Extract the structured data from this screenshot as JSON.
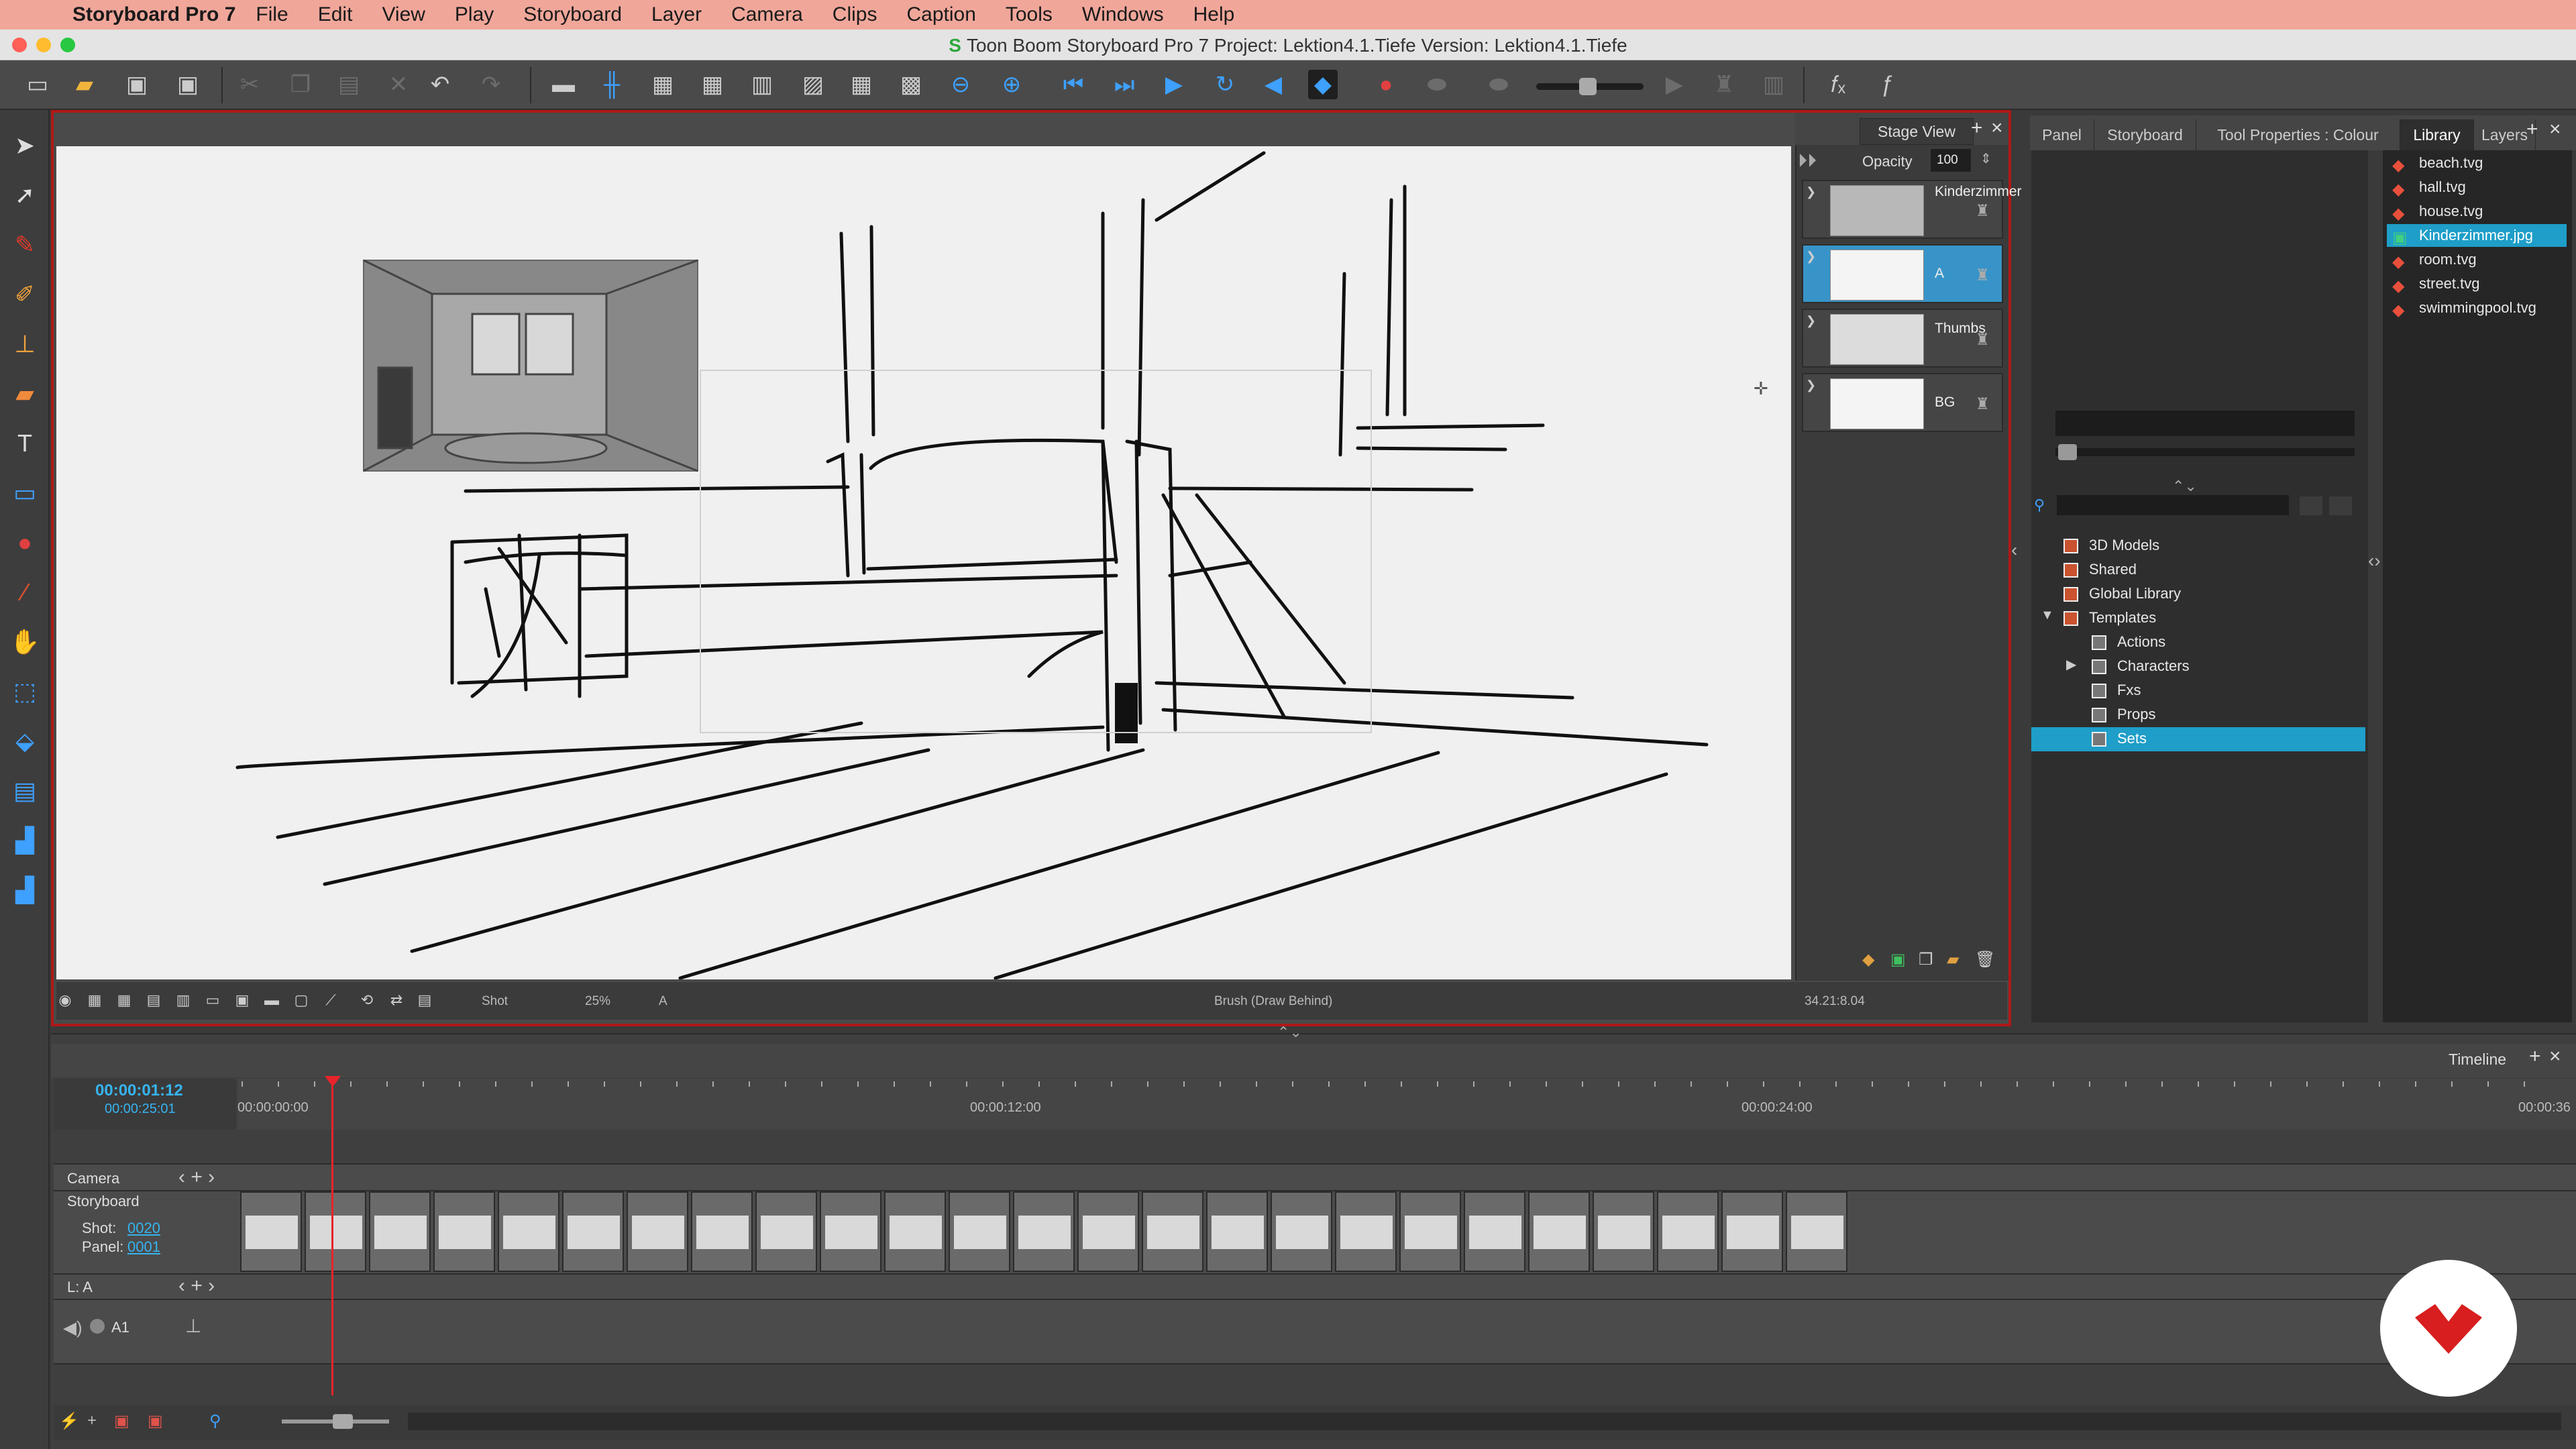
{
  "menubar": {
    "app_name": "Storyboard Pro 7",
    "items": [
      "File",
      "Edit",
      "View",
      "Play",
      "Storyboard",
      "Layer",
      "Camera",
      "Clips",
      "Caption",
      "Tools",
      "Windows",
      "Help"
    ]
  },
  "window": {
    "title": "Toon Boom Storyboard Pro 7 Project: Lektion4.1.Tiefe Version: Lektion4.1.Tiefe"
  },
  "stage": {
    "tab_label": "Stage View",
    "opacity_label": "Opacity",
    "opacity_value": "100",
    "status": {
      "mode": "Shot",
      "zoom": "25%",
      "layer": "A",
      "tool": "Brush (Draw Behind)",
      "coords": "34.21:8.04"
    }
  },
  "layers": [
    {
      "name": "Kinderzimmer",
      "selected": false
    },
    {
      "name": "A",
      "selected": true
    },
    {
      "name": "Thumbs",
      "selected": false
    },
    {
      "name": "BG",
      "selected": false
    }
  ],
  "right_tabs": [
    "Panel",
    "Storyboard",
    "Tool Properties : Colour",
    "Library",
    "Layers"
  ],
  "active_right_tab": "Library",
  "library_files": [
    {
      "name": "beach.tvg",
      "selected": false
    },
    {
      "name": "hall.tvg",
      "selected": false
    },
    {
      "name": "house.tvg",
      "selected": false
    },
    {
      "name": "Kinderzimmer.jpg",
      "selected": true
    },
    {
      "name": "room.tvg",
      "selected": false
    },
    {
      "name": "street.tvg",
      "selected": false
    },
    {
      "name": "swimmingpool.tvg",
      "selected": false
    }
  ],
  "library_tree": [
    {
      "name": "3D Models",
      "level": 0,
      "expander": ""
    },
    {
      "name": "Shared",
      "level": 0,
      "expander": ""
    },
    {
      "name": "Global Library",
      "level": 0,
      "expander": ""
    },
    {
      "name": "Templates",
      "level": 0,
      "expander": "▼"
    },
    {
      "name": "Actions",
      "level": 1,
      "expander": ""
    },
    {
      "name": "Characters",
      "level": 1,
      "expander": "▶"
    },
    {
      "name": "Fxs",
      "level": 1,
      "expander": ""
    },
    {
      "name": "Props",
      "level": 1,
      "expander": ""
    },
    {
      "name": "Sets",
      "level": 1,
      "expander": "",
      "selected": true
    }
  ],
  "timeline": {
    "title": "Timeline",
    "current_time": "00:00:01:12",
    "total_time": "00:00:25:01",
    "ruler": [
      "00:00:00:00",
      "00:00:12:00",
      "00:00:24:00",
      "00:00:36"
    ],
    "camera_label": "Camera",
    "storyboard_label": "Storyboard",
    "shot_label": "Shot:",
    "shot_value": "0020",
    "panel_label": "Panel:",
    "panel_value": "0001",
    "layer_label": "L: A",
    "audio_label": "A1",
    "panel_count": 25
  },
  "colors": {
    "selection": "#1e9ec8",
    "stage_border": "#b01818",
    "playhead": "#e8242a"
  }
}
